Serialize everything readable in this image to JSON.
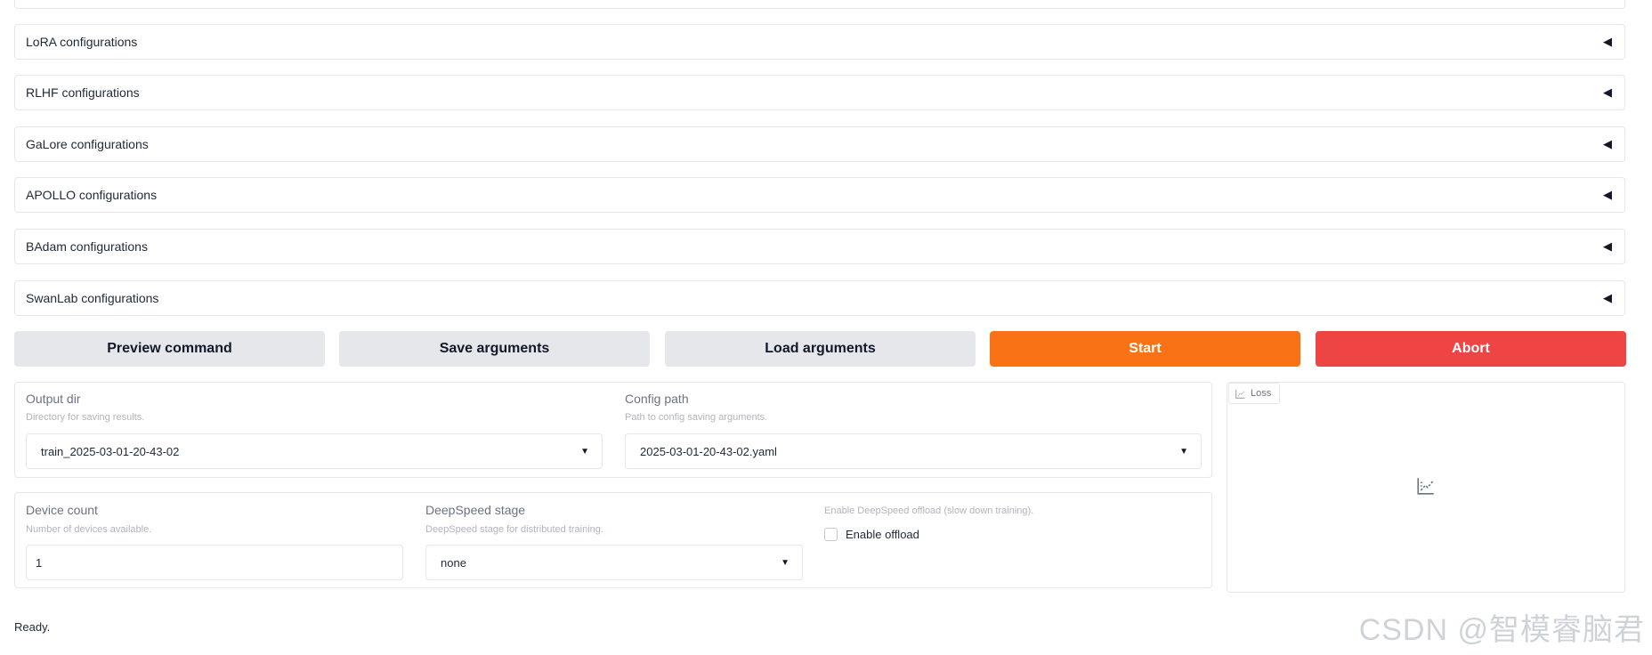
{
  "accordions": [
    {
      "label": "",
      "caret": "◀"
    },
    {
      "label": "LoRA configurations",
      "caret": "◀"
    },
    {
      "label": "RLHF configurations",
      "caret": "◀"
    },
    {
      "label": "GaLore configurations",
      "caret": "◀"
    },
    {
      "label": "APOLLO configurations",
      "caret": "◀"
    },
    {
      "label": "BAdam configurations",
      "caret": "◀"
    },
    {
      "label": "SwanLab configurations",
      "caret": "◀"
    }
  ],
  "actions": {
    "preview": "Preview command",
    "save": "Save arguments",
    "load": "Load arguments",
    "start": "Start",
    "abort": "Abort"
  },
  "output": {
    "label": "Output dir",
    "info": "Directory for saving results.",
    "value": "train_2025-03-01-20-43-02"
  },
  "config": {
    "label": "Config path",
    "info": "Path to config saving arguments.",
    "value": "2025-03-01-20-43-02.yaml"
  },
  "device": {
    "label": "Device count",
    "info": "Number of devices available.",
    "value": "1"
  },
  "deepspeed": {
    "label": "DeepSpeed stage",
    "info": "DeepSpeed stage for distributed training.",
    "value": "none"
  },
  "offload": {
    "info": "Enable DeepSpeed offload (slow down training).",
    "label": "Enable offload",
    "checked": false
  },
  "plot": {
    "tab_label": "Loss",
    "icon": "chart-icon"
  },
  "status": "Ready.",
  "watermark": "CSDN @智模睿脑君",
  "colors": {
    "start": "#f97316",
    "abort": "#ef4444",
    "secondary": "#e5e7eb"
  }
}
